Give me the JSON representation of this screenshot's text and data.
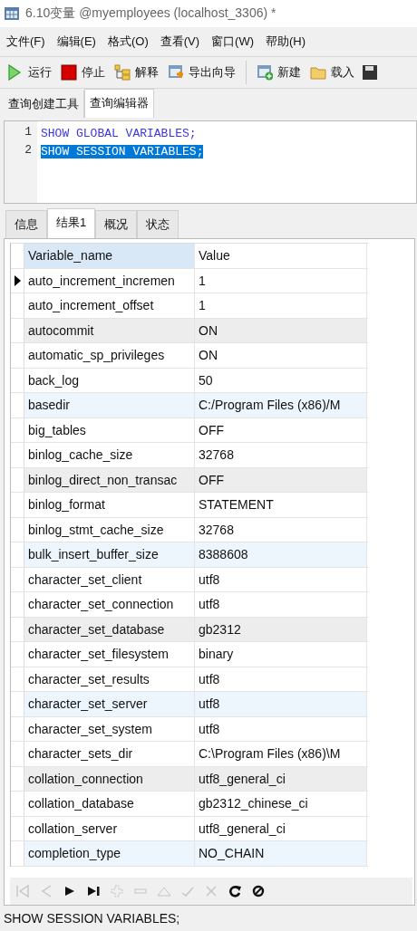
{
  "window": {
    "title": "6.10变量 @myemployees (localhost_3306) *"
  },
  "menu": [
    "文件(F)",
    "编辑(E)",
    "格式(O)",
    "查看(V)",
    "窗口(W)",
    "帮助(H)"
  ],
  "toolbar": [
    {
      "kind": "run",
      "label": "运行"
    },
    {
      "kind": "stop",
      "label": "停止"
    },
    {
      "kind": "explain",
      "label": "解释"
    },
    {
      "kind": "export",
      "label": "导出向导"
    },
    {
      "kind": "separator"
    },
    {
      "kind": "new",
      "label": "新建"
    },
    {
      "kind": "load",
      "label": "载入"
    },
    {
      "kind": "save"
    }
  ],
  "tabs": [
    {
      "label": "查询创建工具",
      "selected": false
    },
    {
      "label": "查询编辑器",
      "selected": true
    }
  ],
  "editor": {
    "lines": [
      {
        "number": "1",
        "code": "SHOW GLOBAL VARIABLES;",
        "selected": false
      },
      {
        "number": "2",
        "code": "SHOW SESSION VARIABLES;",
        "selected": true
      }
    ]
  },
  "result_tabs": [
    {
      "label": "信息",
      "selected": false
    },
    {
      "label": "结果1",
      "selected": true
    },
    {
      "label": "概况",
      "selected": false
    },
    {
      "label": "状态",
      "selected": false
    }
  ],
  "table": {
    "columns": [
      "Variable_name",
      "Value"
    ],
    "rows": [
      {
        "cells": [
          "auto_increment_incremen",
          "1"
        ],
        "current": true,
        "color": "#ffffff"
      },
      {
        "cells": [
          "auto_increment_offset",
          "1"
        ],
        "current": false,
        "color": "#ffffff"
      },
      {
        "cells": [
          "autocommit",
          "ON"
        ],
        "current": false,
        "color": "#ededed"
      },
      {
        "cells": [
          "automatic_sp_privileges",
          "ON"
        ],
        "current": false,
        "color": "#ffffff"
      },
      {
        "cells": [
          "back_log",
          "50"
        ],
        "current": false,
        "color": "#ffffff"
      },
      {
        "cells": [
          "basedir",
          "C:/Program Files (x86)/M"
        ],
        "current": false,
        "color": "#edf5fd"
      },
      {
        "cells": [
          "big_tables",
          "OFF"
        ],
        "current": false,
        "color": "#ffffff"
      },
      {
        "cells": [
          "binlog_cache_size",
          "32768"
        ],
        "current": false,
        "color": "#ffffff"
      },
      {
        "cells": [
          "binlog_direct_non_transac",
          "OFF"
        ],
        "current": false,
        "color": "#ededed"
      },
      {
        "cells": [
          "binlog_format",
          "STATEMENT"
        ],
        "current": false,
        "color": "#ffffff"
      },
      {
        "cells": [
          "binlog_stmt_cache_size",
          "32768"
        ],
        "current": false,
        "color": "#ffffff"
      },
      {
        "cells": [
          "bulk_insert_buffer_size",
          "8388608"
        ],
        "current": false,
        "color": "#edf5fd"
      },
      {
        "cells": [
          "character_set_client",
          "utf8"
        ],
        "current": false,
        "color": "#ffffff"
      },
      {
        "cells": [
          "character_set_connection",
          "utf8"
        ],
        "current": false,
        "color": "#ffffff"
      },
      {
        "cells": [
          "character_set_database",
          "gb2312"
        ],
        "current": false,
        "color": "#ededed"
      },
      {
        "cells": [
          "character_set_filesystem",
          "binary"
        ],
        "current": false,
        "color": "#ffffff"
      },
      {
        "cells": [
          "character_set_results",
          "utf8"
        ],
        "current": false,
        "color": "#ffffff"
      },
      {
        "cells": [
          "character_set_server",
          "utf8"
        ],
        "current": false,
        "color": "#edf5fd"
      },
      {
        "cells": [
          "character_set_system",
          "utf8"
        ],
        "current": false,
        "color": "#ffffff"
      },
      {
        "cells": [
          "character_sets_dir",
          "C:\\Program Files (x86)\\M"
        ],
        "current": false,
        "color": "#ffffff"
      },
      {
        "cells": [
          "collation_connection",
          "utf8_general_ci"
        ],
        "current": false,
        "color": "#ededed"
      },
      {
        "cells": [
          "collation_database",
          "gb2312_chinese_ci"
        ],
        "current": false,
        "color": "#ffffff"
      },
      {
        "cells": [
          "collation_server",
          "utf8_general_ci"
        ],
        "current": false,
        "color": "#ffffff"
      },
      {
        "cells": [
          "completion_type",
          "NO_CHAIN"
        ],
        "current": false,
        "color": "#edf5fd"
      }
    ]
  },
  "navigator": [
    {
      "kind": "first",
      "disabled": true
    },
    {
      "kind": "prev",
      "disabled": true
    },
    {
      "kind": "next",
      "disabled": false
    },
    {
      "kind": "last",
      "disabled": false
    },
    {
      "kind": "add",
      "disabled": true
    },
    {
      "kind": "delete",
      "disabled": true
    },
    {
      "kind": "edit",
      "disabled": true
    },
    {
      "kind": "apply",
      "disabled": true
    },
    {
      "kind": "cancel",
      "disabled": true
    },
    {
      "kind": "refresh",
      "disabled": false
    },
    {
      "kind": "stop",
      "disabled": false
    }
  ],
  "status_bar": {
    "text": "SHOW SESSION VARIABLES;"
  }
}
